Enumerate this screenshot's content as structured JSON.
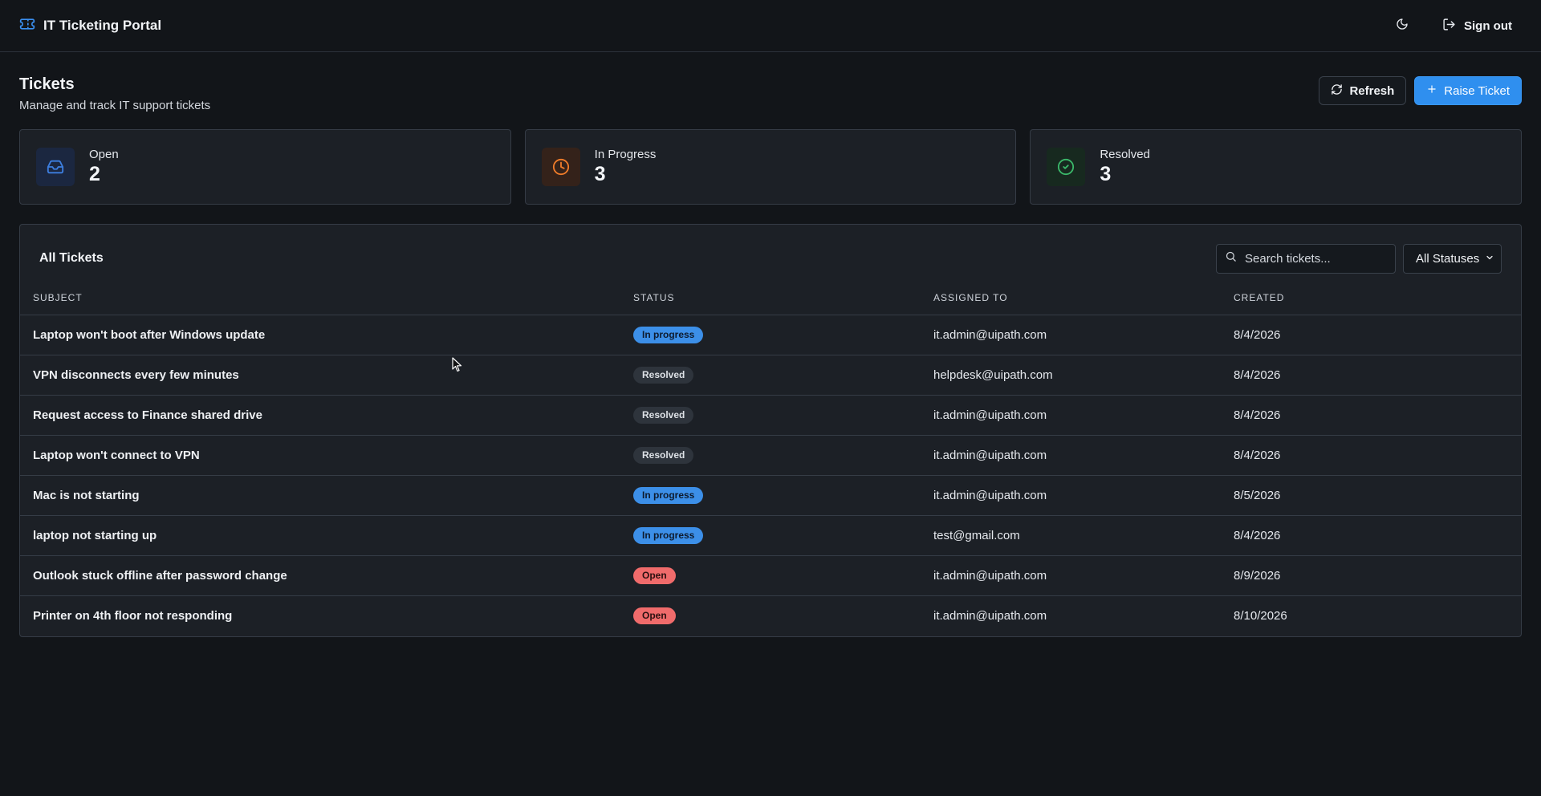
{
  "header": {
    "title": "IT Ticketing Portal",
    "logo_icon": "ticket-icon",
    "theme_icon": "moon-icon",
    "signout_label": "Sign out"
  },
  "page": {
    "title": "Tickets",
    "subtitle": "Manage and track IT support tickets",
    "refresh_label": "Refresh",
    "raise_label": "Raise Ticket"
  },
  "stats": [
    {
      "label": "Open",
      "value": "2",
      "icon": "inbox-icon",
      "color": "#3d7fe0"
    },
    {
      "label": "In Progress",
      "value": "3",
      "icon": "clock-icon",
      "color": "#f07c2a"
    },
    {
      "label": "Resolved",
      "value": "3",
      "icon": "check-circle-icon",
      "color": "#3bb86a"
    }
  ],
  "panel": {
    "title": "All Tickets",
    "search_placeholder": "Search tickets...",
    "status_filter": "All Statuses",
    "columns": [
      "SUBJECT",
      "STATUS",
      "ASSIGNED TO",
      "CREATED"
    ]
  },
  "tickets": [
    {
      "subject": "Laptop won't boot after Windows update",
      "status": "In progress",
      "assigned": "it.admin@uipath.com",
      "created": "8/4/2026"
    },
    {
      "subject": "VPN disconnects every few minutes",
      "status": "Resolved",
      "assigned": "helpdesk@uipath.com",
      "created": "8/4/2026"
    },
    {
      "subject": "Request access to Finance shared drive",
      "status": "Resolved",
      "assigned": "it.admin@uipath.com",
      "created": "8/4/2026"
    },
    {
      "subject": "Laptop won't connect to VPN",
      "status": "Resolved",
      "assigned": "it.admin@uipath.com",
      "created": "8/4/2026"
    },
    {
      "subject": "Mac is not starting",
      "status": "In progress",
      "assigned": "it.admin@uipath.com",
      "created": "8/5/2026"
    },
    {
      "subject": "laptop not starting up",
      "status": "In progress",
      "assigned": "test@gmail.com",
      "created": "8/4/2026"
    },
    {
      "subject": "Outlook stuck offline after password change",
      "status": "Open",
      "assigned": "it.admin@uipath.com",
      "created": "8/9/2026"
    },
    {
      "subject": "Printer on 4th floor not responding",
      "status": "Open",
      "assigned": "it.admin@uipath.com",
      "created": "8/10/2026"
    }
  ]
}
